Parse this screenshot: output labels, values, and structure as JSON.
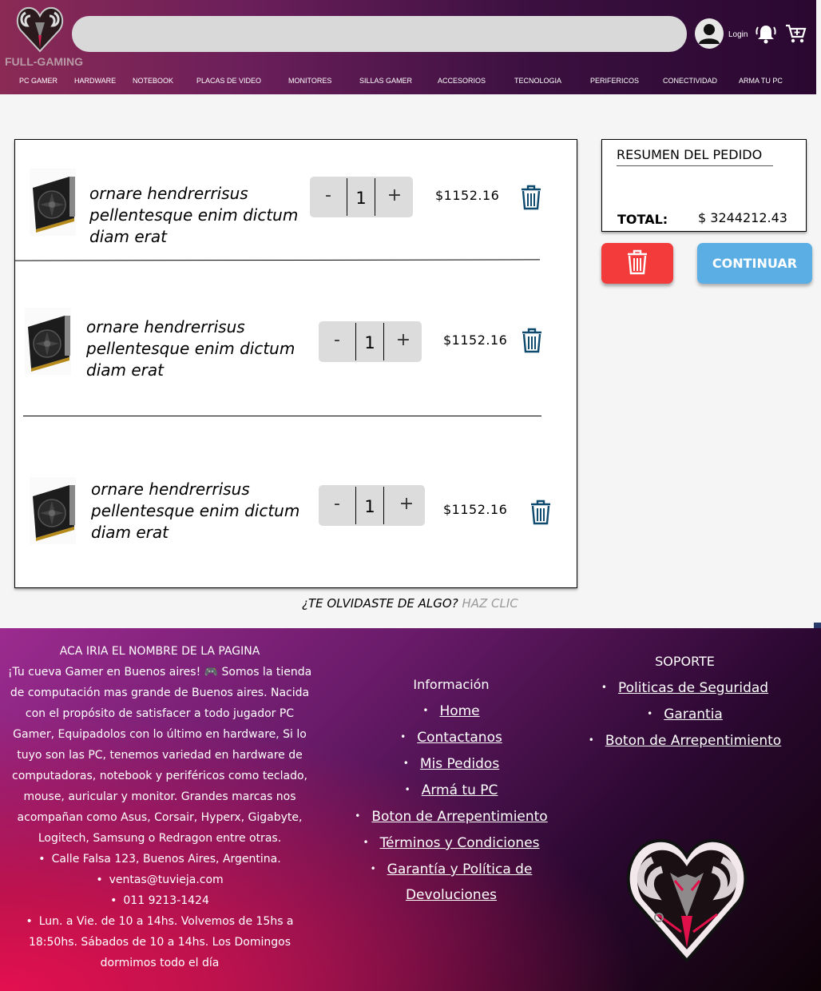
{
  "header": {
    "brand": "FULL-GAMING",
    "search_placeholder": "",
    "login_label": "Login",
    "nav": [
      "PC GAMER",
      "HARDWARE",
      "NOTEBOOK",
      "PLACAS DE VIDEO",
      "MONITORES",
      "SILLAS GAMER",
      "ACCESORIOS",
      "TECNOLOGIA",
      "PERIFERICOS",
      "CONECTIVIDAD",
      "ARMA TU PC"
    ]
  },
  "cart": {
    "items": [
      {
        "name": "ornare hendrerrisus pellentesque enim dictum diam erat",
        "qty": "1",
        "price": "$1152.16",
        "minus": "-",
        "plus": "+"
      },
      {
        "name": "ornare hendrerrisus pellentesque enim dictum diam erat",
        "qty": "1",
        "price": "$1152.16",
        "minus": "-",
        "plus": "+"
      },
      {
        "name": "ornare hendrerrisus pellentesque enim dictum diam erat",
        "qty": "1",
        "price": "$1152.16",
        "minus": "-",
        "plus": "+"
      }
    ]
  },
  "summary": {
    "title": "RESUMEN DEL PEDIDO",
    "total_label": "TOTAL:",
    "total_value": "$ 3244212.43",
    "continue_label": "CONTINUAR"
  },
  "forgot": {
    "question": "¿TE OLVIDASTE DE ALGO?",
    "link": "HAZ CLIC"
  },
  "footer": {
    "about_title": "ACA IRIA EL NOMBRE DE LA PAGINA",
    "about_text": "¡Tu cueva Gamer en Buenos aires! 🎮 Somos la tienda de computación mas grande de Buenos aires. Nacida con el propósito de satisfacer a todo jugador PC Gamer, Equipadolos con lo último en hardware, Si lo tuyo son las PC, tenemos variedad en hardware de computadoras, notebook y periféricos como teclado, mouse, auricular y monitor. Grandes marcas nos acompañan como Asus, Corsair, Hyperx, Gigabyte, Logitech, Samsung o Redragon entre otras.",
    "contact": [
      "Calle Falsa 123, Buenos Aires, Argentina.",
      "ventas@tuvieja.com",
      "011 9213-1424",
      "Lun. a Vie. de 10 a 14hs. Volvemos de 15hs a 18:50hs. Sábados de 10 a 14hs. Los Domingos dormimos todo el día"
    ],
    "info_title": "Información",
    "info_links": [
      "Home",
      "Contactanos",
      "Mis Pedidos",
      "Armá tu PC",
      "Boton de Arrepentimiento",
      "Términos y Condiciones",
      "Garantía y Política de Devoluciones"
    ],
    "support_title": "SOPORTE",
    "support_links": [
      "Politicas de Seguridad",
      "Garantia",
      "Boton de Arrepentimiento"
    ]
  },
  "colors": {
    "delete_button": "#f33b3b",
    "continue_button": "#5aaee4",
    "trash_icon": "#0e4b6e"
  },
  "icons": [
    "user-icon",
    "bell-icon",
    "cart-icon",
    "trash-icon",
    "gpu-image",
    "ram-heart-logo"
  ]
}
